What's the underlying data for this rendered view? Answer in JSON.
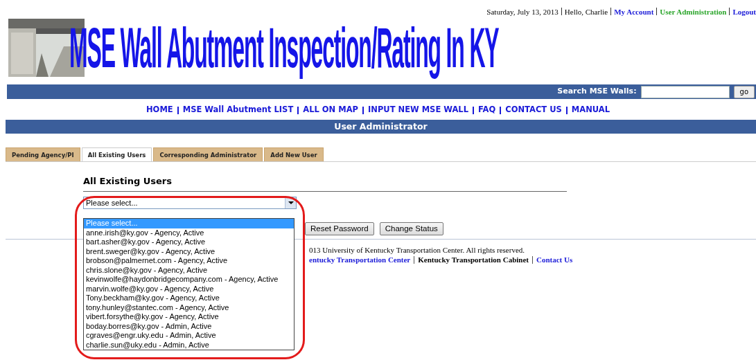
{
  "top_bar": {
    "date": "Saturday, July 13, 2013",
    "greeting": "Hello, Charlie",
    "links": [
      {
        "label": "My Account",
        "kind": "account"
      },
      {
        "label": "User Administration",
        "kind": "admin"
      },
      {
        "label": "Logout",
        "kind": "account"
      }
    ]
  },
  "banner": {
    "title": "MSE Wall Abutment Inspection/Rating In KY"
  },
  "search": {
    "label": "Search MSE Walls:",
    "button": "go"
  },
  "nav": [
    "HOME",
    "MSE Wall Abutment LIST",
    "ALL ON MAP",
    "INPUT NEW MSE WALL",
    "FAQ",
    "CONTACT US",
    "MANUAL"
  ],
  "section_title": "User Administrator",
  "tabs": [
    {
      "label": "Pending Agency/PI",
      "selected": false
    },
    {
      "label": "All Existing Users",
      "selected": true
    },
    {
      "label": "Corresponding Administrator",
      "selected": false
    },
    {
      "label": "Add New User",
      "selected": false
    }
  ],
  "panel": {
    "heading": "All Existing Users",
    "dropdown": {
      "value": "Please select...",
      "expanded": true,
      "highlighted": true,
      "options": [
        {
          "label": "Please select...",
          "selected": true
        },
        {
          "label": "anne.irish@ky.gov - Agency, Active",
          "selected": false
        },
        {
          "label": "bart.asher@ky.gov - Agency, Active",
          "selected": false
        },
        {
          "label": "brent.sweger@ky.gov - Agency, Active",
          "selected": false
        },
        {
          "label": "brobson@palmernet.com - Agency, Active",
          "selected": false
        },
        {
          "label": "chris.slone@ky.gov - Agency, Active",
          "selected": false
        },
        {
          "label": "kevinwolfe@haydonbridgecompany.com - Agency, Active",
          "selected": false
        },
        {
          "label": "marvin.wolfe@ky.gov - Agency, Active",
          "selected": false
        },
        {
          "label": "Tony.beckham@ky.gov - Agency, Active",
          "selected": false
        },
        {
          "label": "tony.hunley@stantec.com - Agency, Active",
          "selected": false
        },
        {
          "label": "vibert.forsythe@ky.gov - Agency, Active",
          "selected": false
        },
        {
          "label": "boday.borres@ky.gov - Admin, Active",
          "selected": false
        },
        {
          "label": "cgraves@engr.uky.edu - Admin, Active",
          "selected": false
        },
        {
          "label": "charlie.sun@uky.edu - Admin, Active",
          "selected": false
        }
      ]
    },
    "buttons": [
      "Reset Password",
      "Change Status"
    ]
  },
  "footer": {
    "copyright": "013 University of Kentucky Transportation Center. All rights reserved.",
    "links": [
      {
        "label": "entucky Transportation Center",
        "kind": "link"
      },
      {
        "label": "Kentucky Transportation Cabinet",
        "kind": "plain"
      },
      {
        "label": "Contact Us",
        "kind": "link"
      }
    ]
  }
}
